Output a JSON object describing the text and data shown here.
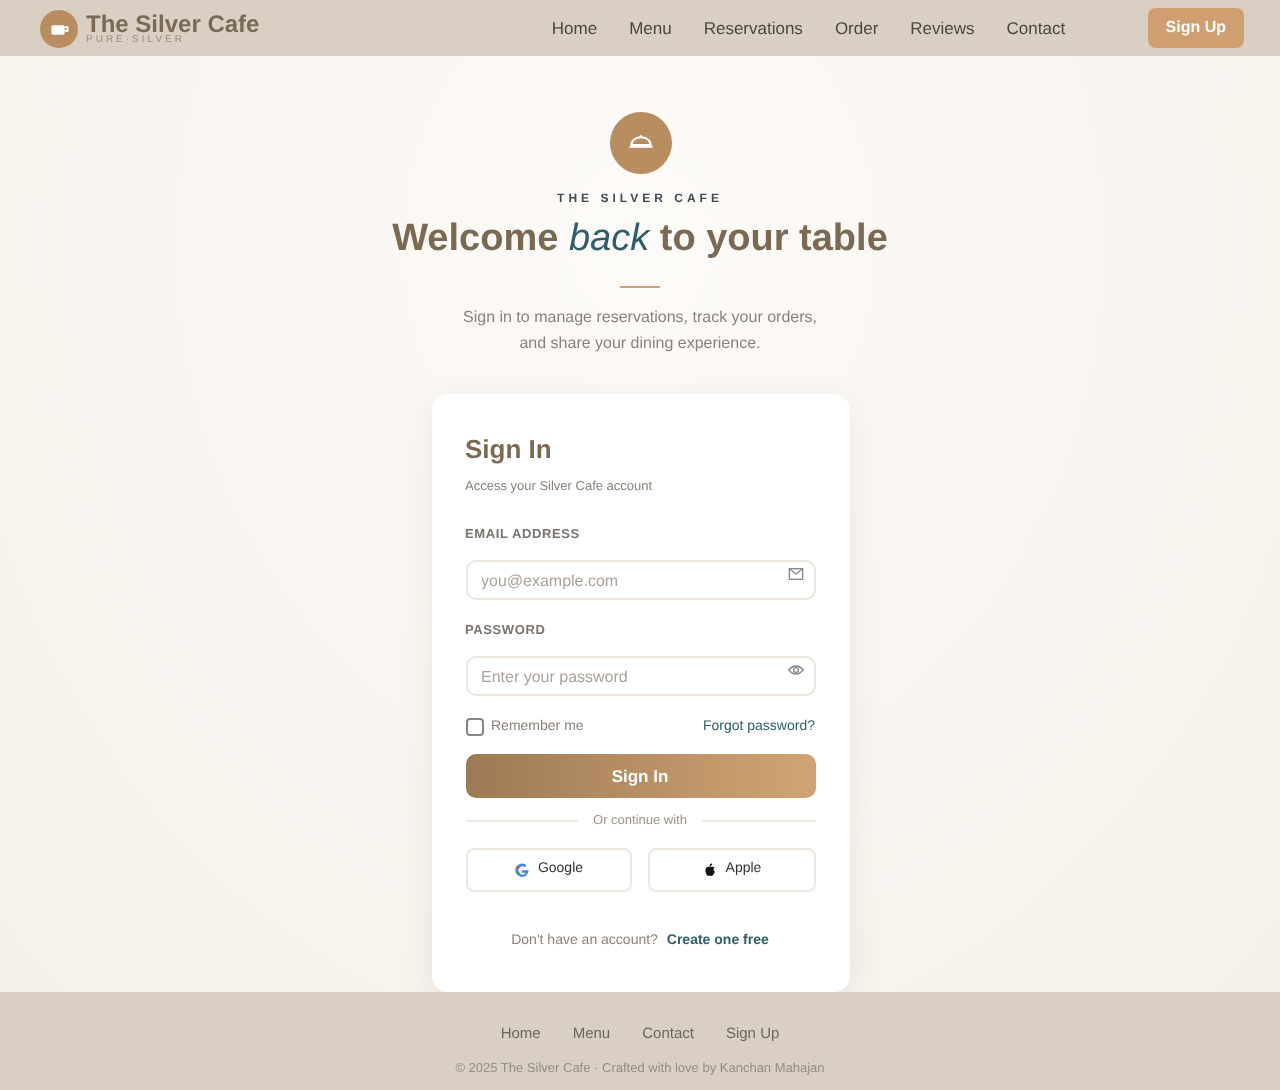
{
  "brand": {
    "name": "The Silver Cafe",
    "tagline": "PURE·SILVER"
  },
  "nav": [
    {
      "label": "Home"
    },
    {
      "label": "Menu"
    },
    {
      "label": "Reservations"
    },
    {
      "label": "Order"
    },
    {
      "label": "Reviews"
    },
    {
      "label": "Contact"
    }
  ],
  "signup_button": "Sign Up",
  "hero": {
    "eyebrow": "THE SILVER CAFE",
    "title": "Welcome *back* to your table",
    "subtitle_lines": [
      "Sign in to manage reservations, track your orders,",
      "and share your dining experience."
    ]
  },
  "form": {
    "title": "Sign In",
    "subtitle": "Access your Silver Cafe account",
    "fields": [
      {
        "label": "EMAIL ADDRESS",
        "placeholder": "you@example.com",
        "kind": "email"
      },
      {
        "label": "PASSWORD",
        "placeholder": "Enter your password",
        "kind": "password"
      }
    ],
    "remember": {
      "label": "Remember me",
      "checked": false
    },
    "forgot": "Forgot password?",
    "submit": "Sign In",
    "divider": "Or continue with",
    "social": [
      {
        "label": "Google",
        "kind": "google"
      },
      {
        "label": "Apple",
        "kind": "apple"
      }
    ],
    "footer_text": "Don't have an account?",
    "footer_link": "Create one free"
  },
  "footer": {
    "links": [
      {
        "label": "Home"
      },
      {
        "label": "Menu"
      },
      {
        "label": "Contact"
      },
      {
        "label": "Sign Up"
      }
    ],
    "copyright": "© 2025 The Silver Cafe · Crafted with love by Kanchan Mahajan"
  }
}
